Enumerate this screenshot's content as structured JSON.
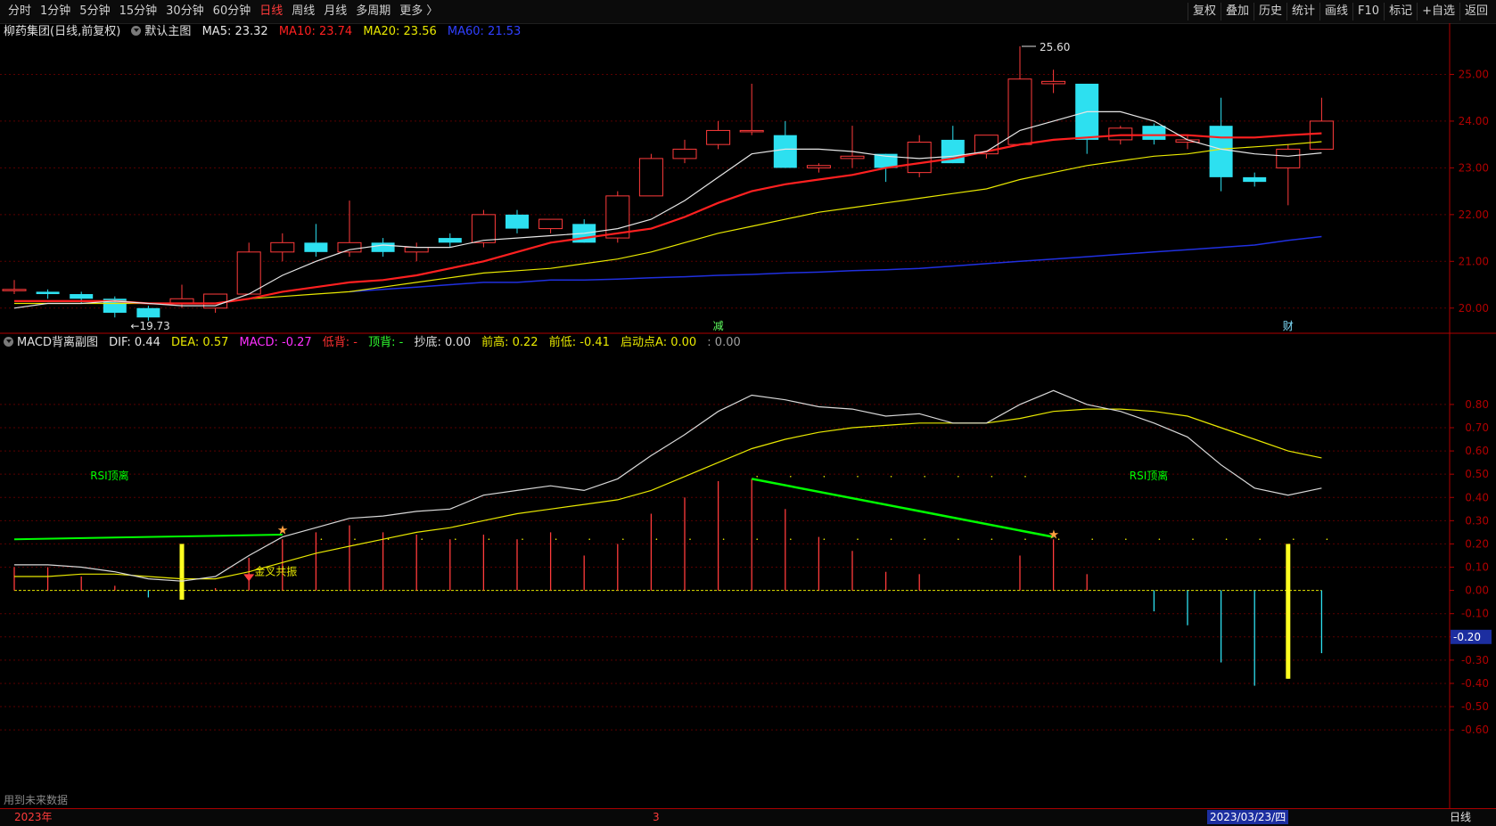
{
  "toolbar": {
    "periods": [
      "分时",
      "1分钟",
      "5分钟",
      "15分钟",
      "30分钟",
      "60分钟",
      "日线",
      "周线",
      "月线",
      "多周期",
      "更多 〉"
    ],
    "active_period": "日线",
    "right_tools": [
      "复权",
      "叠加",
      "历史",
      "统计",
      "画线",
      "F10",
      "标记",
      "+自选",
      "返回"
    ]
  },
  "main_info": {
    "stock": "柳药集团(日线,前复权)",
    "template": "默认主图",
    "ma5": "MA5: 23.32",
    "ma10": "MA10: 23.74",
    "ma20": "MA20: 23.56",
    "ma60": "MA60: 21.53"
  },
  "sub_info": {
    "name": "MACD背离副图",
    "dif": "DIF: 0.44",
    "dea": "DEA: 0.57",
    "macd": "MACD: -0.27",
    "low_div": "低背: -",
    "top_div": "顶背: -",
    "bottom": "抄底: 0.00",
    "prev_high": "前高: 0.22",
    "prev_low": "前低: -0.41",
    "start_a": "启动点A: 0.00",
    "extra": ": 0.00"
  },
  "colors": {
    "up": "#ff3b3b",
    "down": "#2de0f0",
    "ma5": "#e6e6e6",
    "ma10": "#ff2020",
    "ma20": "#e8e800",
    "ma60": "#2030e0",
    "grid": "#5a0000",
    "axis": "#b00000",
    "green": "#00ff00"
  },
  "chart_data": [
    {
      "type": "candlestick",
      "y_ticks": [
        "25.00",
        "24.00",
        "23.00",
        "22.00",
        "21.00",
        "20.00"
      ],
      "ylim": [
        19.5,
        25.6
      ],
      "high_label": "25.60",
      "low_label": "19.73",
      "markers": [
        {
          "text": "减",
          "index": 21
        },
        {
          "text": "财",
          "index": 38
        }
      ],
      "candles": [
        {
          "o": 20.4,
          "h": 20.6,
          "l": 20.3,
          "c": 20.4
        },
        {
          "o": 20.35,
          "h": 20.4,
          "l": 20.2,
          "c": 20.3
        },
        {
          "o": 20.3,
          "h": 20.35,
          "l": 20.1,
          "c": 20.2
        },
        {
          "o": 20.2,
          "h": 20.25,
          "l": 19.8,
          "c": 19.9
        },
        {
          "o": 20.0,
          "h": 20.05,
          "l": 19.73,
          "c": 19.8
        },
        {
          "o": 20.1,
          "h": 20.5,
          "l": 20.0,
          "c": 20.2
        },
        {
          "o": 20.0,
          "h": 20.3,
          "l": 19.9,
          "c": 20.3
        },
        {
          "o": 20.3,
          "h": 21.4,
          "l": 20.3,
          "c": 21.2
        },
        {
          "o": 21.2,
          "h": 21.6,
          "l": 21.0,
          "c": 21.4
        },
        {
          "o": 21.4,
          "h": 21.8,
          "l": 21.1,
          "c": 21.2
        },
        {
          "o": 21.2,
          "h": 22.3,
          "l": 21.1,
          "c": 21.4
        },
        {
          "o": 21.4,
          "h": 21.5,
          "l": 21.1,
          "c": 21.2
        },
        {
          "o": 21.2,
          "h": 21.4,
          "l": 21.0,
          "c": 21.3
        },
        {
          "o": 21.5,
          "h": 21.6,
          "l": 21.3,
          "c": 21.4
        },
        {
          "o": 21.4,
          "h": 22.1,
          "l": 21.3,
          "c": 22.0
        },
        {
          "o": 22.0,
          "h": 22.1,
          "l": 21.6,
          "c": 21.7
        },
        {
          "o": 21.7,
          "h": 21.9,
          "l": 21.6,
          "c": 21.9
        },
        {
          "o": 21.8,
          "h": 21.9,
          "l": 21.4,
          "c": 21.4
        },
        {
          "o": 21.5,
          "h": 22.5,
          "l": 21.4,
          "c": 22.4
        },
        {
          "o": 22.4,
          "h": 23.3,
          "l": 22.4,
          "c": 23.2
        },
        {
          "o": 23.2,
          "h": 23.6,
          "l": 23.1,
          "c": 23.4
        },
        {
          "o": 23.5,
          "h": 24.0,
          "l": 23.4,
          "c": 23.8
        },
        {
          "o": 23.8,
          "h": 24.8,
          "l": 23.7,
          "c": 23.8
        },
        {
          "o": 23.7,
          "h": 24.0,
          "l": 23.0,
          "c": 23.0
        },
        {
          "o": 23.0,
          "h": 23.1,
          "l": 22.9,
          "c": 23.05
        },
        {
          "o": 23.2,
          "h": 23.9,
          "l": 23.0,
          "c": 23.25
        },
        {
          "o": 23.3,
          "h": 23.3,
          "l": 22.7,
          "c": 23.0
        },
        {
          "o": 22.9,
          "h": 23.7,
          "l": 22.8,
          "c": 23.55
        },
        {
          "o": 23.6,
          "h": 23.9,
          "l": 23.1,
          "c": 23.1
        },
        {
          "o": 23.3,
          "h": 23.7,
          "l": 23.2,
          "c": 23.7
        },
        {
          "o": 23.5,
          "h": 25.6,
          "l": 23.5,
          "c": 24.9
        },
        {
          "o": 24.8,
          "h": 25.1,
          "l": 24.6,
          "c": 24.85
        },
        {
          "o": 24.8,
          "h": 24.8,
          "l": 23.3,
          "c": 23.6
        },
        {
          "o": 23.6,
          "h": 23.9,
          "l": 23.5,
          "c": 23.85
        },
        {
          "o": 23.9,
          "h": 23.95,
          "l": 23.5,
          "c": 23.6
        },
        {
          "o": 23.55,
          "h": 23.7,
          "l": 23.4,
          "c": 23.6
        },
        {
          "o": 23.9,
          "h": 24.5,
          "l": 22.5,
          "c": 22.8
        },
        {
          "o": 22.8,
          "h": 22.9,
          "l": 22.6,
          "c": 22.7
        },
        {
          "o": 23.0,
          "h": 23.5,
          "l": 22.2,
          "c": 23.4
        },
        {
          "o": 23.4,
          "h": 24.5,
          "l": 23.4,
          "c": 24.0
        }
      ],
      "ma5": [
        20.0,
        20.1,
        20.1,
        20.15,
        20.1,
        20.05,
        20.05,
        20.3,
        20.7,
        21.0,
        21.25,
        21.35,
        21.3,
        21.3,
        21.45,
        21.5,
        21.55,
        21.6,
        21.7,
        21.9,
        22.3,
        22.8,
        23.3,
        23.4,
        23.4,
        23.35,
        23.25,
        23.2,
        23.25,
        23.35,
        23.8,
        24.0,
        24.2,
        24.2,
        24.0,
        23.6,
        23.4,
        23.3,
        23.25,
        23.32
      ],
      "ma10": [
        20.15,
        20.15,
        20.15,
        20.15,
        20.1,
        20.1,
        20.1,
        20.2,
        20.35,
        20.45,
        20.55,
        20.6,
        20.7,
        20.85,
        21.0,
        21.2,
        21.4,
        21.5,
        21.6,
        21.7,
        21.95,
        22.25,
        22.5,
        22.65,
        22.75,
        22.85,
        23.0,
        23.1,
        23.2,
        23.35,
        23.5,
        23.6,
        23.65,
        23.7,
        23.7,
        23.7,
        23.65,
        23.65,
        23.7,
        23.74
      ],
      "ma20": [
        20.1,
        20.1,
        20.1,
        20.1,
        20.1,
        20.1,
        20.1,
        20.2,
        20.25,
        20.3,
        20.35,
        20.45,
        20.55,
        20.65,
        20.75,
        20.8,
        20.85,
        20.95,
        21.05,
        21.2,
        21.4,
        21.6,
        21.75,
        21.9,
        22.05,
        22.15,
        22.25,
        22.35,
        22.45,
        22.55,
        22.75,
        22.9,
        23.05,
        23.15,
        23.25,
        23.3,
        23.4,
        23.45,
        23.5,
        23.56
      ],
      "ma60": [
        null,
        null,
        null,
        null,
        null,
        null,
        null,
        null,
        null,
        null,
        20.35,
        20.4,
        20.45,
        20.5,
        20.55,
        20.55,
        20.6,
        20.6,
        20.62,
        20.65,
        20.67,
        20.7,
        20.72,
        20.75,
        20.77,
        20.8,
        20.82,
        20.85,
        20.9,
        20.95,
        21.0,
        21.05,
        21.1,
        21.15,
        21.2,
        21.25,
        21.3,
        21.35,
        21.45,
        21.53
      ]
    },
    {
      "type": "bar",
      "title": "MACD背离副图",
      "y_ticks": [
        "0.80",
        "0.70",
        "0.60",
        "0.50",
        "0.40",
        "0.30",
        "0.20",
        "0.10",
        "0.00",
        "-0.10",
        "-0.20",
        "-0.30",
        "-0.40",
        "-0.50",
        "-0.60"
      ],
      "ylim": [
        -0.68,
        0.93
      ],
      "current_value": "-0.20",
      "dif": [
        0.11,
        0.11,
        0.1,
        0.08,
        0.05,
        0.04,
        0.06,
        0.15,
        0.23,
        0.27,
        0.31,
        0.32,
        0.34,
        0.35,
        0.41,
        0.43,
        0.45,
        0.43,
        0.48,
        0.58,
        0.67,
        0.77,
        0.84,
        0.82,
        0.79,
        0.78,
        0.75,
        0.76,
        0.72,
        0.72,
        0.8,
        0.86,
        0.8,
        0.77,
        0.72,
        0.66,
        0.54,
        0.44,
        0.41,
        0.44
      ],
      "dea": [
        0.06,
        0.06,
        0.07,
        0.07,
        0.06,
        0.05,
        0.05,
        0.08,
        0.12,
        0.16,
        0.19,
        0.22,
        0.25,
        0.27,
        0.3,
        0.33,
        0.35,
        0.37,
        0.39,
        0.43,
        0.49,
        0.55,
        0.61,
        0.65,
        0.68,
        0.7,
        0.71,
        0.72,
        0.72,
        0.72,
        0.74,
        0.77,
        0.78,
        0.78,
        0.77,
        0.75,
        0.7,
        0.65,
        0.6,
        0.57
      ],
      "macd": [
        0.1,
        0.1,
        0.06,
        0.02,
        -0.03,
        -0.02,
        0.01,
        0.14,
        0.22,
        0.25,
        0.28,
        0.25,
        0.24,
        0.22,
        0.24,
        0.22,
        0.25,
        0.15,
        0.2,
        0.33,
        0.4,
        0.47,
        0.48,
        0.35,
        0.23,
        0.17,
        0.08,
        0.07,
        0.0,
        0.0,
        0.15,
        0.22,
        0.07,
        0.0,
        -0.09,
        -0.15,
        -0.31,
        -0.41,
        -0.38,
        -0.27
      ],
      "top_line_value": 0.22,
      "rsi_labels": [
        {
          "text": "RSI顶离",
          "index": 2
        },
        {
          "text": "RSI顶离",
          "index": 33
        }
      ],
      "signal": {
        "text": "金叉共振",
        "index": 7
      },
      "yellow_bars": [
        5,
        38
      ]
    }
  ],
  "bottom": {
    "year": "2023年",
    "month": "3",
    "date": "2023/03/23/四",
    "period": "日线",
    "note": "用到未来数据"
  }
}
